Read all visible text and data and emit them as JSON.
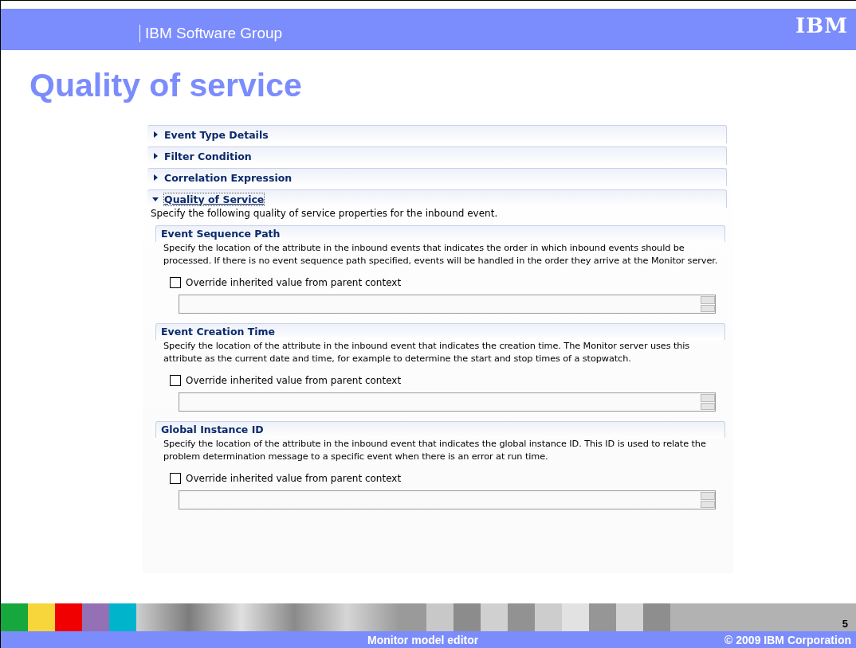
{
  "header": {
    "group": "IBM Software Group",
    "logo": "IBM"
  },
  "title": "Quality of service",
  "sections": [
    {
      "label": "Event Type Details",
      "expanded": false
    },
    {
      "label": "Filter Condition",
      "expanded": false
    },
    {
      "label": "Correlation Expression",
      "expanded": false
    },
    {
      "label": "Quality of Service",
      "expanded": true,
      "description": "Specify the following quality of service properties for the inbound event.",
      "groups": [
        {
          "title": "Event Sequence Path",
          "description": "Specify the location of the attribute in the inbound events that indicates the order in which inbound events should be processed. If there is no event sequence path specified, events will be handled in the order they arrive at the Monitor server.",
          "override": {
            "label": "Override inherited value from parent context",
            "checked": false
          }
        },
        {
          "title": "Event Creation Time",
          "description": "Specify the location of the attribute in the inbound event that indicates the creation time. The Monitor server uses this attribute as the current date and time, for example to determine the start and stop times of a stopwatch.",
          "override": {
            "label": "Override inherited value from parent context",
            "checked": false
          }
        },
        {
          "title": "Global Instance ID",
          "description": "Specify the location of the attribute in the inbound event that indicates the global instance ID.  This ID is used to relate the problem determination message to a specific event when there is an error at run time.",
          "override": {
            "label": "Override inherited value from parent context",
            "checked": false
          }
        }
      ]
    }
  ],
  "footer": {
    "page": "5",
    "subject": "Monitor model editor",
    "copyright": "© 2009 IBM Corporation"
  }
}
